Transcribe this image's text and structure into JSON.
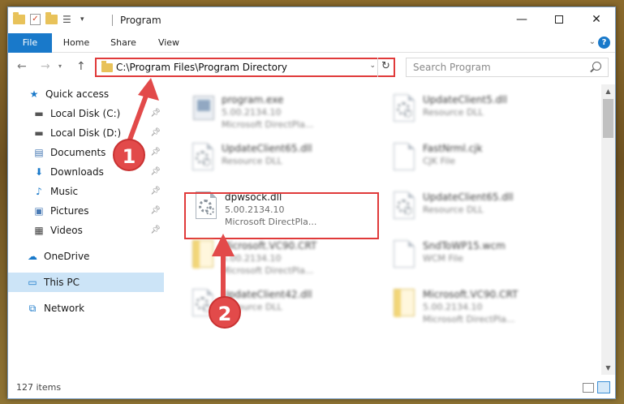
{
  "titlebar": {
    "title": "Program",
    "minimize": "—",
    "close": "✕"
  },
  "ribbon": {
    "tabs": [
      "File",
      "Home",
      "Share",
      "View"
    ],
    "help": "?"
  },
  "address": {
    "path": "C:\\Program Files\\Program Directory",
    "refresh": "↻"
  },
  "search": {
    "placeholder": "Search Program"
  },
  "sidebar": {
    "items": [
      {
        "label": "Quick access",
        "icon": "star-icon",
        "pinned": false
      },
      {
        "label": "Local Disk (C:)",
        "icon": "drive-icon",
        "pinned": true
      },
      {
        "label": "Local Disk (D:)",
        "icon": "drive-icon",
        "pinned": true
      },
      {
        "label": "Documents",
        "icon": "documents-icon",
        "pinned": true
      },
      {
        "label": "Downloads",
        "icon": "download-icon",
        "pinned": true
      },
      {
        "label": "Music",
        "icon": "music-icon",
        "pinned": true
      },
      {
        "label": "Pictures",
        "icon": "pictures-icon",
        "pinned": true
      },
      {
        "label": "Videos",
        "icon": "videos-icon",
        "pinned": true
      },
      {
        "label": "OneDrive",
        "icon": "cloud-icon",
        "pinned": false
      },
      {
        "label": "This PC",
        "icon": "computer-icon",
        "pinned": false,
        "selected": true
      },
      {
        "label": "Network",
        "icon": "network-icon",
        "pinned": false
      }
    ]
  },
  "files": [
    {
      "name": "program.exe",
      "line2": "5.00.2134.10",
      "line3": "Microsoft DirectPla...",
      "icon": "exe-icon",
      "blurred": true
    },
    {
      "name": "UpdateClient5.dll",
      "line2": "Resource DLL",
      "line3": "",
      "icon": "dll-icon",
      "blurred": true
    },
    {
      "name": "UpdateClient65.dll",
      "line2": "Resource DLL",
      "line3": "",
      "icon": "dll-icon",
      "blurred": true
    },
    {
      "name": "FastNrml.cjk",
      "line2": "CJK File",
      "line3": "",
      "icon": "file-icon",
      "blurred": true
    },
    {
      "name": "dpwsock.dll",
      "line2": "5.00.2134.10",
      "line3": "Microsoft DirectPla...",
      "icon": "dll-icon",
      "blurred": false,
      "highlighted": true
    },
    {
      "name": "UpdateClient65.dll",
      "line2": "Resource DLL",
      "line3": "",
      "icon": "dll-icon",
      "blurred": true
    },
    {
      "name": "Microsoft.VC90.CRT",
      "line2": "5.00.2134.10",
      "line3": "Microsoft DirectPla...",
      "icon": "folder-doc-icon",
      "blurred": true
    },
    {
      "name": "SndToWP15.wcm",
      "line2": "WCM File",
      "line3": "",
      "icon": "file-icon",
      "blurred": true
    },
    {
      "name": "UpdateClient42.dll",
      "line2": "Resource DLL",
      "line3": "",
      "icon": "dll-icon",
      "blurred": true
    },
    {
      "name": "Microsoft.VC90.CRT",
      "line2": "5.00.2134.10",
      "line3": "Microsoft DirectPla...",
      "icon": "folder-doc-icon",
      "blurred": true
    }
  ],
  "status": {
    "item_count": "127 items"
  },
  "steps": [
    "1",
    "2"
  ],
  "colors": {
    "accent": "#1979ca",
    "highlight": "#e03a3a",
    "selected": "#cce4f7"
  }
}
